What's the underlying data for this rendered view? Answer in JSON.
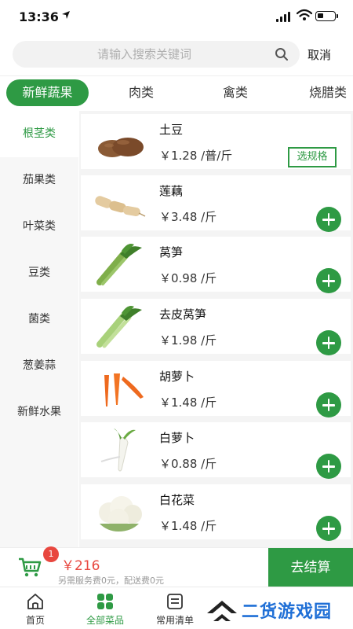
{
  "status_bar": {
    "time": "13:36",
    "location_arrow": "location-arrow-icon"
  },
  "search": {
    "placeholder": "请输入搜索关键词",
    "value": "",
    "cancel_label": "取消"
  },
  "top_tabs": [
    {
      "label": "新鲜蔬果",
      "active": true
    },
    {
      "label": "肉类",
      "active": false
    },
    {
      "label": "禽类",
      "active": false
    },
    {
      "label": "烧腊类",
      "active": false
    }
  ],
  "sidebar": [
    {
      "label": "根茎类",
      "active": true
    },
    {
      "label": "茄果类",
      "active": false
    },
    {
      "label": "叶菜类",
      "active": false
    },
    {
      "label": "豆类",
      "active": false
    },
    {
      "label": "菌类",
      "active": false
    },
    {
      "label": "葱姜蒜",
      "active": false
    },
    {
      "label": "新鲜水果",
      "active": false
    }
  ],
  "products": [
    {
      "name": "土豆",
      "price": "￥1.28 /普/斤",
      "action": "spec",
      "action_label": "选规格",
      "image": "potato"
    },
    {
      "name": "莲藕",
      "price": "￥3.48 /斤",
      "action": "add",
      "image": "lotus-root"
    },
    {
      "name": "莴笋",
      "price": "￥0.98 /斤",
      "action": "add",
      "image": "celtuce"
    },
    {
      "name": "去皮莴笋",
      "price": "￥1.98 /斤",
      "action": "add",
      "image": "celtuce"
    },
    {
      "name": "胡萝卜",
      "price": "￥1.48 /斤",
      "action": "add",
      "image": "carrot"
    },
    {
      "name": "白萝卜",
      "price": "￥0.88 /斤",
      "action": "add",
      "image": "white-radish"
    },
    {
      "name": "白花菜",
      "price": "￥1.48 /斤",
      "action": "add",
      "image": "cauliflower"
    }
  ],
  "cart": {
    "badge_count": "1",
    "total": "￥216",
    "note": "另需服务费0元，配送费0元",
    "checkout_label": "去结算"
  },
  "bottom_tabs": [
    {
      "label": "首页",
      "icon": "home-icon",
      "active": false
    },
    {
      "label": "全部菜品",
      "icon": "grid-icon",
      "active": true
    },
    {
      "label": "常用清单",
      "icon": "list-icon",
      "active": false
    }
  ],
  "watermark": {
    "text": "二货游戏园"
  },
  "colors": {
    "accent": "#2e9a44",
    "price_red": "#e8473f",
    "watermark_blue": "#1f6fd6"
  }
}
